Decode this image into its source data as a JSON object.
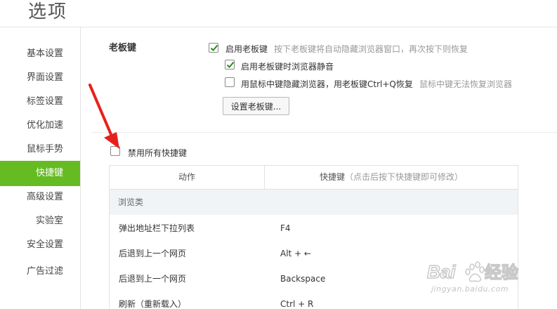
{
  "window": {
    "title": "选项"
  },
  "sidebar": {
    "items": [
      {
        "label": "基本设置",
        "active": false
      },
      {
        "label": "界面设置",
        "active": false
      },
      {
        "label": "标签设置",
        "active": false
      },
      {
        "label": "优化加速",
        "active": false
      },
      {
        "label": "鼠标手势",
        "active": false
      },
      {
        "label": "快捷键",
        "active": true
      },
      {
        "label": "高级设置",
        "active": false
      },
      {
        "label": "实验室",
        "active": false
      },
      {
        "label": "安全设置",
        "active": false
      },
      {
        "label": "广告过滤",
        "active": false
      }
    ],
    "active_color": "#66bb22"
  },
  "boss_key": {
    "section_label": "老板键",
    "enable": {
      "label": "启用老板键",
      "checked": true,
      "hint": "按下老板键将自动隐藏浏览器窗口，再次按下则恢复"
    },
    "mute": {
      "label": "启用老板键时浏览器静音",
      "checked": true
    },
    "middle_click": {
      "label": "用鼠标中键隐藏浏览器，用老板键Ctrl+Q恢复",
      "checked": false,
      "hint": "鼠标中键无法恢复浏览器"
    },
    "button_label": "设置老板键..."
  },
  "disable_all": {
    "label": "禁用所有快捷键",
    "checked": false
  },
  "shortcut_table": {
    "col_action": "动作",
    "col_key": "快捷键",
    "col_key_hint": "（点击后按下快捷键即可修改）",
    "category": "浏览类",
    "rows": [
      {
        "action": "弹出地址栏下拉列表",
        "key": "F4"
      },
      {
        "action": "后退到上一个网页",
        "key": "Alt + ←"
      },
      {
        "action": "后退到上一个网页",
        "key": "Backspace"
      },
      {
        "action": "刷新（重新载入）",
        "key": "Ctrl + R"
      }
    ]
  },
  "watermark": {
    "brand": "Bai",
    "brand2": "du",
    "suffix": "经验",
    "url": "jingyan.baidu.com"
  },
  "annotation": {
    "arrow_color": "#e8201c",
    "icon": "red-arrow-icon"
  }
}
